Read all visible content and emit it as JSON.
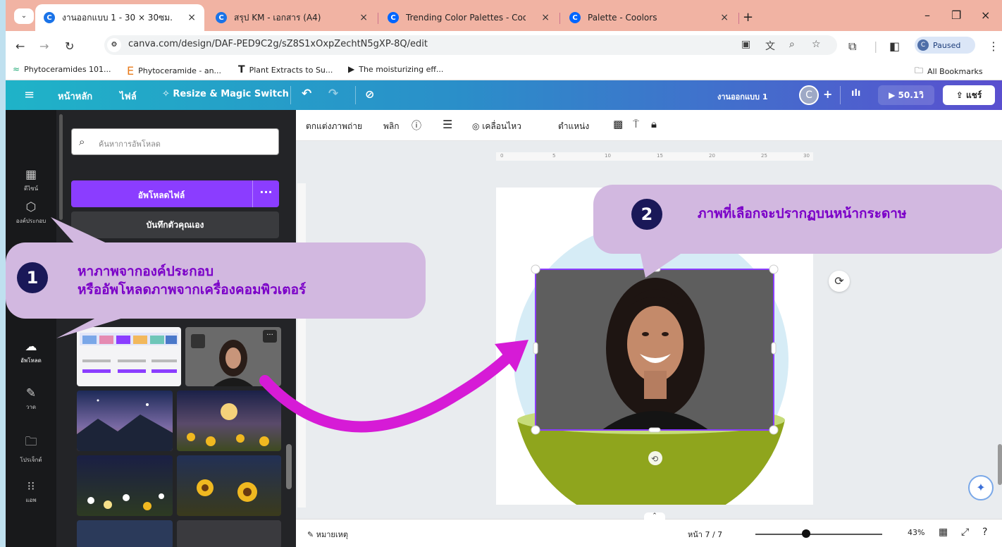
{
  "browser": {
    "tabs": [
      {
        "title": "งานออกแบบ 1 - 30 × 30ซม.",
        "active": true,
        "favicon": "canva-icon",
        "color": "#1a73e8"
      },
      {
        "title": "สรุป KM - เอกสาร (A4)",
        "active": false,
        "favicon": "canva-icon",
        "color": "#1a73e8"
      },
      {
        "title": "Trending Color Palettes - Coolors",
        "active": false,
        "favicon": "coolors-icon",
        "color": "#0066ff"
      },
      {
        "title": "Palette - Coolors",
        "active": false,
        "favicon": "coolors-icon",
        "color": "#0066ff"
      }
    ],
    "url": "canva.com/design/DAF-PED9C2g/sZ8S1xOxpZechtN5gXP-8Q/edit",
    "profile_label": "Paused",
    "profile_initial": "C",
    "bookmarks": [
      "Phytoceramides 101...",
      "Phytoceramide - an...",
      "Plant Extracts to Su...",
      "The moisturizing eff..."
    ],
    "all_bookmarks_label": "All Bookmarks"
  },
  "canva_header": {
    "home": "หน้าหลัก",
    "file": "ไฟล์",
    "resize": "Resize & Magic Switch",
    "design_name": "งานออกแบบ 1",
    "avatar_initial": "C",
    "present_label": "50.1วิ",
    "share_label": "แชร์"
  },
  "rail": [
    {
      "icon": "template-icon",
      "label": "ดีไซน์"
    },
    {
      "icon": "elements-icon",
      "label": "องค์ประกอบ"
    },
    {
      "icon": "upload-icon",
      "label": "อัพโหลด"
    },
    {
      "icon": "draw-icon",
      "label": "วาด"
    },
    {
      "icon": "folder-icon",
      "label": "โปรเจ็กต์"
    },
    {
      "icon": "apps-icon",
      "label": "แอพ"
    }
  ],
  "panel": {
    "search_placeholder": "ค้นหาการอัพโหลด",
    "upload_label": "อัพโหลดไฟล์",
    "record_label": "บันทึกตัวคุณเอง"
  },
  "toolbar": {
    "edit_photo": "ตกแต่งภาพถ่าย",
    "flip": "พลิก",
    "animate": "เคลื่อนไหว",
    "position": "ตำแหน่ง"
  },
  "ruler_ticks": [
    "0",
    "5",
    "10",
    "15",
    "20",
    "25",
    "30"
  ],
  "footer": {
    "notes_label": "หมายเหตุ",
    "page_label": "หน้า 7 / 7",
    "zoom_label": "43%",
    "zoom_level": 0.43
  },
  "callouts": {
    "step1_number": "1",
    "step1_line1": "หาภาพจากองค์ประกอบ",
    "step1_line2": "หรืออัพโหลดภาพจากเครื่องคอมพิวเตอร์",
    "step2_number": "2",
    "step2_text": "ภาพที่เลือกจะปรากฏบนหน้ากระดาษ"
  },
  "colors": {
    "accent_purple": "#8b3dff",
    "callout_bg": "#d2b8e0",
    "callout_text": "#7b00c8",
    "arrow": "#d61bd6",
    "number_badge": "#1a1858",
    "tab_bar": "#f1b3a3"
  }
}
